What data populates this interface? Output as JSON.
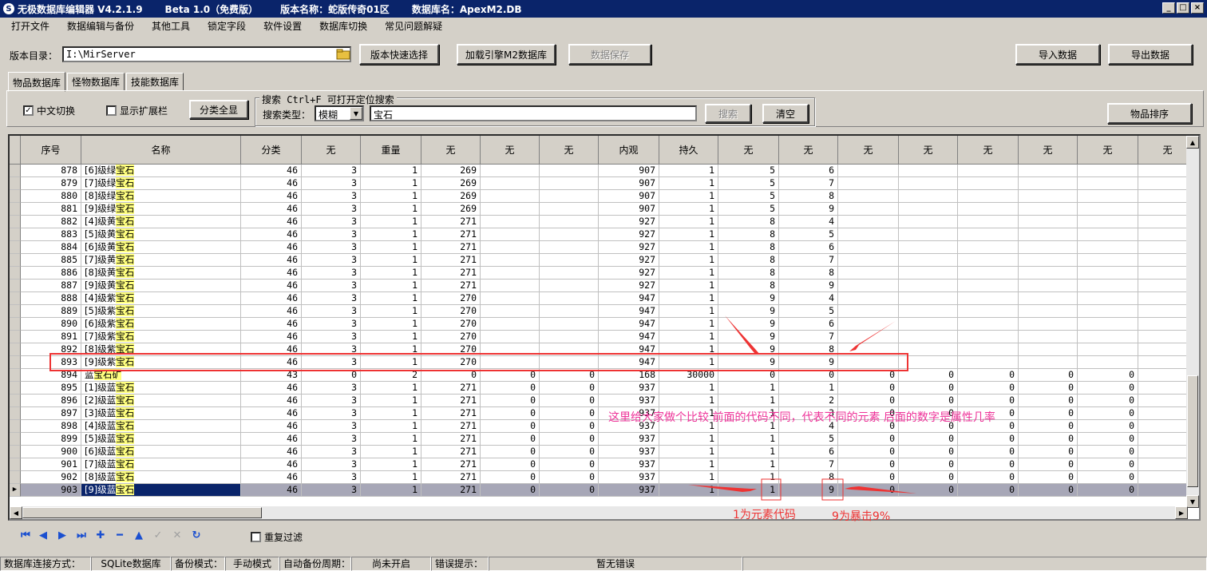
{
  "window": {
    "title_parts": [
      "无极数据库编辑器 V4.2.1.9",
      "Beta 1.0（免费版）",
      "版本名称：蛇版传奇01区",
      "数据库名：ApexM2.DB"
    ],
    "min": "_",
    "max": "□",
    "close": "×"
  },
  "menu": [
    "打开文件",
    "数据编辑与备份",
    "其他工具",
    "锁定字段",
    "软件设置",
    "数据库切换",
    "常见问题解疑"
  ],
  "toolbar": {
    "version_dir_label": "版本目录：",
    "version_dir_value": "I:\\MirServer",
    "quick_select": "版本快速选择",
    "load_engine": "加载引擎M2数据库",
    "save_data": "数据保存",
    "import_data": "导入数据",
    "export_data": "导出数据"
  },
  "tabs": [
    "物品数据库",
    "怪物数据库",
    "技能数据库"
  ],
  "panel": {
    "chinese_switch": "中文切换",
    "show_ext": "显示扩展栏",
    "show_all_categories": "分类全显",
    "search_group_title": "搜索  Ctrl+F 可打开定位搜索",
    "search_type_label": "搜索类型：",
    "search_type_value": "模糊",
    "search_text": "宝石",
    "search_btn": "搜索",
    "clear_btn": "清空",
    "sort_btn": "物品排序"
  },
  "grid": {
    "columns": [
      "序号",
      "名称",
      "分类",
      "无",
      "重量",
      "无",
      "无",
      "无",
      "内观",
      "持久",
      "无",
      "无",
      "无",
      "无",
      "无",
      "无",
      "无",
      "无"
    ],
    "rows": [
      [
        "878",
        "[6]级绿",
        "宝石",
        "46",
        "3",
        "1",
        "269",
        "",
        "",
        "907",
        "1",
        "5",
        "6",
        "",
        "",
        "",
        "",
        "",
        ""
      ],
      [
        "879",
        "[7]级绿",
        "宝石",
        "46",
        "3",
        "1",
        "269",
        "",
        "",
        "907",
        "1",
        "5",
        "7",
        "",
        "",
        "",
        "",
        "",
        ""
      ],
      [
        "880",
        "[8]级绿",
        "宝石",
        "46",
        "3",
        "1",
        "269",
        "",
        "",
        "907",
        "1",
        "5",
        "8",
        "",
        "",
        "",
        "",
        "",
        ""
      ],
      [
        "881",
        "[9]级绿",
        "宝石",
        "46",
        "3",
        "1",
        "269",
        "",
        "",
        "907",
        "1",
        "5",
        "9",
        "",
        "",
        "",
        "",
        "",
        ""
      ],
      [
        "882",
        "[4]级黄",
        "宝石",
        "46",
        "3",
        "1",
        "271",
        "",
        "",
        "927",
        "1",
        "8",
        "4",
        "",
        "",
        "",
        "",
        "",
        ""
      ],
      [
        "883",
        "[5]级黄",
        "宝石",
        "46",
        "3",
        "1",
        "271",
        "",
        "",
        "927",
        "1",
        "8",
        "5",
        "",
        "",
        "",
        "",
        "",
        ""
      ],
      [
        "884",
        "[6]级黄",
        "宝石",
        "46",
        "3",
        "1",
        "271",
        "",
        "",
        "927",
        "1",
        "8",
        "6",
        "",
        "",
        "",
        "",
        "",
        ""
      ],
      [
        "885",
        "[7]级黄",
        "宝石",
        "46",
        "3",
        "1",
        "271",
        "",
        "",
        "927",
        "1",
        "8",
        "7",
        "",
        "",
        "",
        "",
        "",
        ""
      ],
      [
        "886",
        "[8]级黄",
        "宝石",
        "46",
        "3",
        "1",
        "271",
        "",
        "",
        "927",
        "1",
        "8",
        "8",
        "",
        "",
        "",
        "",
        "",
        ""
      ],
      [
        "887",
        "[9]级黄",
        "宝石",
        "46",
        "3",
        "1",
        "271",
        "",
        "",
        "927",
        "1",
        "8",
        "9",
        "",
        "",
        "",
        "",
        "",
        ""
      ],
      [
        "888",
        "[4]级紫",
        "宝石",
        "46",
        "3",
        "1",
        "270",
        "",
        "",
        "947",
        "1",
        "9",
        "4",
        "",
        "",
        "",
        "",
        "",
        ""
      ],
      [
        "889",
        "[5]级紫",
        "宝石",
        "46",
        "3",
        "1",
        "270",
        "",
        "",
        "947",
        "1",
        "9",
        "5",
        "",
        "",
        "",
        "",
        "",
        ""
      ],
      [
        "890",
        "[6]级紫",
        "宝石",
        "46",
        "3",
        "1",
        "270",
        "",
        "",
        "947",
        "1",
        "9",
        "6",
        "",
        "",
        "",
        "",
        "",
        ""
      ],
      [
        "891",
        "[7]级紫",
        "宝石",
        "46",
        "3",
        "1",
        "270",
        "",
        "",
        "947",
        "1",
        "9",
        "7",
        "",
        "",
        "",
        "",
        "",
        ""
      ],
      [
        "892",
        "[8]级紫",
        "宝石",
        "46",
        "3",
        "1",
        "270",
        "",
        "",
        "947",
        "1",
        "9",
        "8",
        "",
        "",
        "",
        "",
        "",
        ""
      ],
      [
        "893",
        "[9]级紫",
        "宝石",
        "46",
        "3",
        "1",
        "270",
        "",
        "",
        "947",
        "1",
        "9",
        "9",
        "",
        "",
        "",
        "",
        "",
        ""
      ],
      [
        "894",
        "蓝",
        "宝石矿",
        "43",
        "0",
        "2",
        "0",
        "0",
        "0",
        "168",
        "30000",
        "0",
        "0",
        "0",
        "0",
        "0",
        "0",
        "0",
        "0"
      ],
      [
        "895",
        "[1]级蓝",
        "宝石",
        "46",
        "3",
        "1",
        "271",
        "0",
        "0",
        "937",
        "1",
        "1",
        "1",
        "0",
        "0",
        "0",
        "0",
        "0",
        "0"
      ],
      [
        "896",
        "[2]级蓝",
        "宝石",
        "46",
        "3",
        "1",
        "271",
        "0",
        "0",
        "937",
        "1",
        "1",
        "2",
        "0",
        "0",
        "0",
        "0",
        "0",
        "0"
      ],
      [
        "897",
        "[3]级蓝",
        "宝石",
        "46",
        "3",
        "1",
        "271",
        "0",
        "0",
        "937",
        "1",
        "1",
        "3",
        "0",
        "0",
        "0",
        "0",
        "0",
        "0"
      ],
      [
        "898",
        "[4]级蓝",
        "宝石",
        "46",
        "3",
        "1",
        "271",
        "0",
        "0",
        "937",
        "1",
        "1",
        "4",
        "0",
        "0",
        "0",
        "0",
        "0",
        "0"
      ],
      [
        "899",
        "[5]级蓝",
        "宝石",
        "46",
        "3",
        "1",
        "271",
        "0",
        "0",
        "937",
        "1",
        "1",
        "5",
        "0",
        "0",
        "0",
        "0",
        "0",
        "0"
      ],
      [
        "900",
        "[6]级蓝",
        "宝石",
        "46",
        "3",
        "1",
        "271",
        "0",
        "0",
        "937",
        "1",
        "1",
        "6",
        "0",
        "0",
        "0",
        "0",
        "0",
        "0"
      ],
      [
        "901",
        "[7]级蓝",
        "宝石",
        "46",
        "3",
        "1",
        "271",
        "0",
        "0",
        "937",
        "1",
        "1",
        "7",
        "0",
        "0",
        "0",
        "0",
        "0",
        "0"
      ],
      [
        "902",
        "[8]级蓝",
        "宝石",
        "46",
        "3",
        "1",
        "271",
        "0",
        "0",
        "937",
        "1",
        "1",
        "8",
        "0",
        "0",
        "0",
        "0",
        "0",
        "0"
      ],
      [
        "903",
        "[9]级蓝",
        "宝石",
        "46",
        "3",
        "1",
        "271",
        "0",
        "0",
        "937",
        "1",
        "1",
        "9",
        "0",
        "0",
        "0",
        "0",
        "0",
        "0"
      ]
    ],
    "selected_row": "903",
    "boxed_row": "893"
  },
  "nav": {
    "icons": [
      "first-icon",
      "prior-icon",
      "next-icon",
      "last-icon",
      "insert-icon",
      "delete-icon",
      "edit-icon",
      "post-icon",
      "cancel-icon",
      "refresh-icon"
    ],
    "dup_filter": "重复过滤"
  },
  "status": {
    "conn_label": "数据库连接方式：",
    "conn_value": "SQLite数据库",
    "backup_label": "备份模式：",
    "backup_value": "手动模式",
    "auto_label": "自动备份周期：",
    "auto_value": "尚未开启",
    "err_label": "错误提示：",
    "err_value": "暂无错误"
  },
  "annotations": {
    "main": "这里给大家做个比较 前面的代码不同，代表不同的元素  后面的数字是属性几率",
    "element_code": "1为元素代码",
    "crit": "9为暴击9%"
  },
  "colors": {
    "title_bg": "#0a246a",
    "highlight": "#ffff80",
    "annotation_pink": "#ee3399",
    "annotation_red": "#ee3333"
  }
}
